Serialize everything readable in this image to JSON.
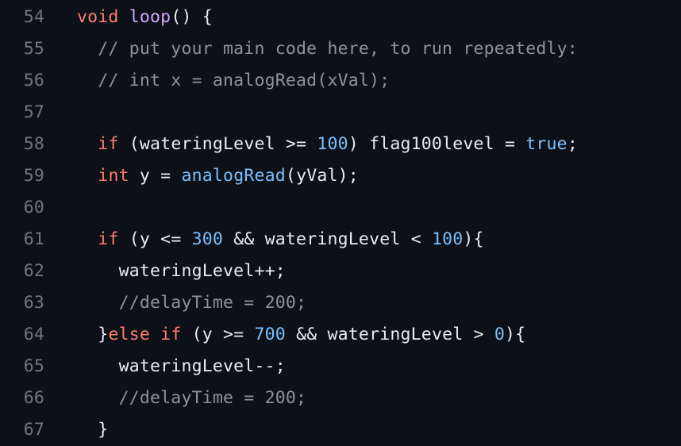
{
  "theme": {
    "background": "#0d1117",
    "line_number": "#6e7681",
    "plain": "#e6edf3",
    "keyword": "#ff7b72",
    "function": "#d2a8ff",
    "number": "#79c0ff",
    "comment": "#8b949e"
  },
  "lines": [
    {
      "number": "54",
      "tokens": [
        {
          "text": "void",
          "type": "keyword"
        },
        {
          "text": " ",
          "type": "plain"
        },
        {
          "text": "loop",
          "type": "function"
        },
        {
          "text": "() {",
          "type": "plain"
        }
      ]
    },
    {
      "number": "55",
      "tokens": [
        {
          "text": "  // put your main code here, to run repeatedly:",
          "type": "comment"
        }
      ]
    },
    {
      "number": "56",
      "tokens": [
        {
          "text": "  // int x = analogRead(xVal);",
          "type": "comment"
        }
      ]
    },
    {
      "number": "57",
      "tokens": []
    },
    {
      "number": "58",
      "tokens": [
        {
          "text": "  ",
          "type": "plain"
        },
        {
          "text": "if",
          "type": "keyword"
        },
        {
          "text": " (wateringLevel >= ",
          "type": "plain"
        },
        {
          "text": "100",
          "type": "number"
        },
        {
          "text": ") flag100level = ",
          "type": "plain"
        },
        {
          "text": "true",
          "type": "constant"
        },
        {
          "text": ";",
          "type": "plain"
        }
      ]
    },
    {
      "number": "59",
      "tokens": [
        {
          "text": "  ",
          "type": "plain"
        },
        {
          "text": "int",
          "type": "keyword"
        },
        {
          "text": " y = ",
          "type": "plain"
        },
        {
          "text": "analogRead",
          "type": "call"
        },
        {
          "text": "(yVal);",
          "type": "plain"
        }
      ]
    },
    {
      "number": "60",
      "tokens": []
    },
    {
      "number": "61",
      "tokens": [
        {
          "text": "  ",
          "type": "plain"
        },
        {
          "text": "if",
          "type": "keyword"
        },
        {
          "text": " (y <= ",
          "type": "plain"
        },
        {
          "text": "300",
          "type": "number"
        },
        {
          "text": " && wateringLevel < ",
          "type": "plain"
        },
        {
          "text": "100",
          "type": "number"
        },
        {
          "text": "){",
          "type": "plain"
        }
      ]
    },
    {
      "number": "62",
      "tokens": [
        {
          "text": "    wateringLevel++;",
          "type": "plain"
        }
      ]
    },
    {
      "number": "63",
      "tokens": [
        {
          "text": "    //delayTime = 200;",
          "type": "comment"
        }
      ]
    },
    {
      "number": "64",
      "tokens": [
        {
          "text": "  }",
          "type": "plain"
        },
        {
          "text": "else",
          "type": "keyword"
        },
        {
          "text": " ",
          "type": "plain"
        },
        {
          "text": "if",
          "type": "keyword"
        },
        {
          "text": " (y >= ",
          "type": "plain"
        },
        {
          "text": "700",
          "type": "number"
        },
        {
          "text": " && wateringLevel > ",
          "type": "plain"
        },
        {
          "text": "0",
          "type": "number"
        },
        {
          "text": "){",
          "type": "plain"
        }
      ]
    },
    {
      "number": "65",
      "tokens": [
        {
          "text": "    wateringLevel--;",
          "type": "plain"
        }
      ]
    },
    {
      "number": "66",
      "tokens": [
        {
          "text": "    //delayTime = 200;",
          "type": "comment"
        }
      ]
    },
    {
      "number": "67",
      "tokens": [
        {
          "text": "  }",
          "type": "plain"
        }
      ]
    }
  ]
}
